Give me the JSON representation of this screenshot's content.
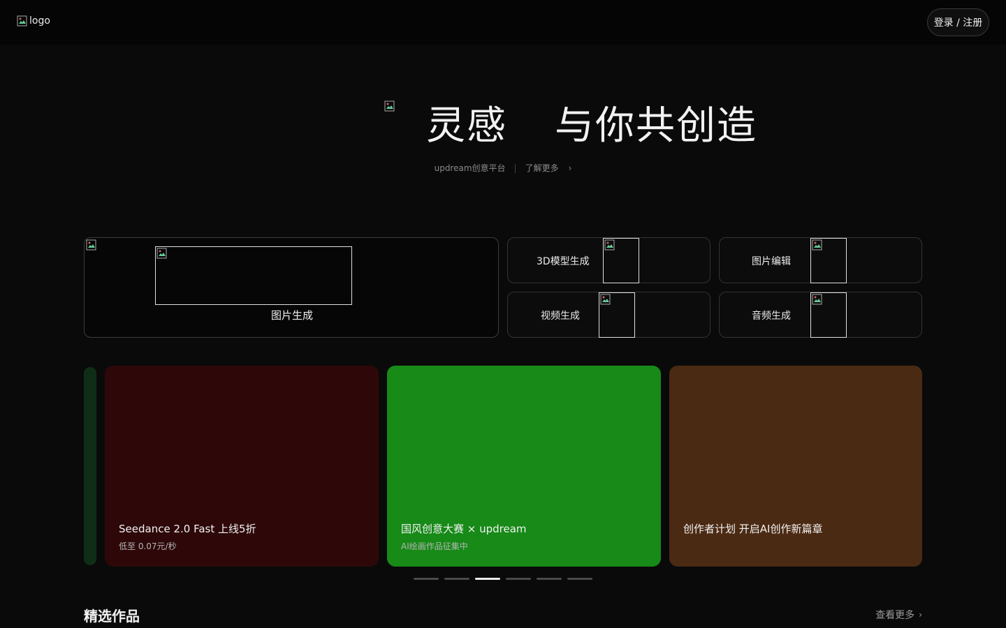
{
  "header": {
    "logo_alt": "logo",
    "login_label": "登录 / 注册"
  },
  "hero": {
    "title_part1": "灵感",
    "title_part2": "与你共创造",
    "subtitle_left": "updream创意平台",
    "subtitle_separator": "|",
    "subtitle_link": "了解更多",
    "chevron": "›"
  },
  "tools": {
    "main_label": "图片生成",
    "items": [
      {
        "label": "3D模型生成"
      },
      {
        "label": "视频生成"
      },
      {
        "label": "图片编辑"
      },
      {
        "label": "音频生成"
      }
    ]
  },
  "carousel": {
    "cards": [
      {
        "title": "",
        "subtitle": "",
        "color": "#0f2e17"
      },
      {
        "title": "Seedance 2.0 Fast 上线5折",
        "subtitle": "低至 0.07元/秒",
        "color": "#2e0809"
      },
      {
        "title": "国风创意大赛 × updream",
        "subtitle": "AI绘画作品征集中",
        "color": "#178a18"
      },
      {
        "title": "创作者计划 开启AI创作新篇章",
        "subtitle": "",
        "color": "#4b2a13"
      }
    ],
    "dots": [
      {
        "active": false
      },
      {
        "active": false
      },
      {
        "active": true
      },
      {
        "active": false
      },
      {
        "active": false
      },
      {
        "active": false
      }
    ]
  },
  "section": {
    "title": "精选作品",
    "more_label": "查看更多",
    "chevron": "›"
  }
}
